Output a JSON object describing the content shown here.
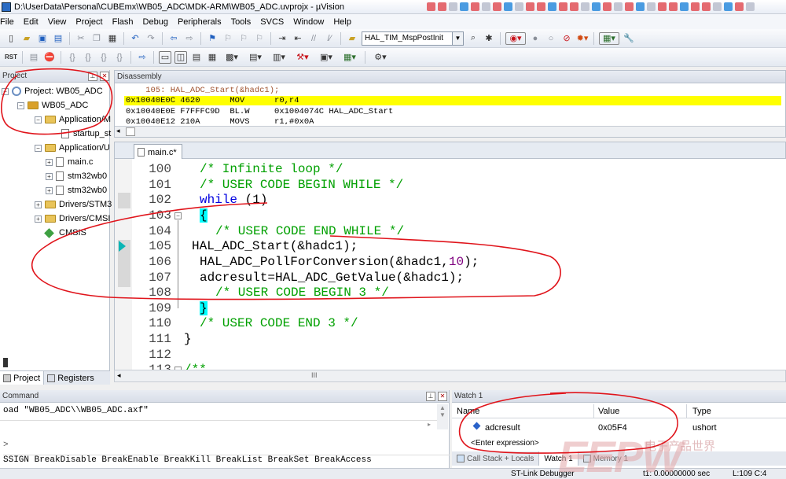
{
  "window": {
    "title": "D:\\UserData\\Personal\\CUBEmx\\WB05_ADC\\MDK-ARM\\WB05_ADC.uvprojx - µVision"
  },
  "menu": [
    "File",
    "Edit",
    "View",
    "Project",
    "Flash",
    "Debug",
    "Peripherals",
    "Tools",
    "SVCS",
    "Window",
    "Help"
  ],
  "toolbar": {
    "function_combo": "HAL_TIM_MspPostInit",
    "rst_label": "RST"
  },
  "project_panel": {
    "title": "Project",
    "items": [
      {
        "label": "Project: WB05_ADC"
      },
      {
        "label": "WB05_ADC"
      },
      {
        "label": "Application/M"
      },
      {
        "label": "startup_st"
      },
      {
        "label": "Application/U"
      },
      {
        "label": "main.c"
      },
      {
        "label": "stm32wb0"
      },
      {
        "label": "stm32wb0"
      },
      {
        "label": "Drivers/STM3"
      },
      {
        "label": "Drivers/CMSI"
      },
      {
        "label": "CMSIS"
      }
    ],
    "tabs": {
      "project": "Project",
      "registers": "Registers"
    }
  },
  "disassembly": {
    "title": "Disassembly",
    "lines": [
      "    105: HAL_ADC_Start(&hadc1);",
      "0x10040E0C 4620      MOV      r0,r4",
      "0x10040E0E F7FFFC9D  BL.W     0x1004074C HAL_ADC_Start",
      "0x10040E12 210A      MOVS     r1,#0x0A"
    ]
  },
  "editor": {
    "tab": "main.c*",
    "line_numbers": [
      "100",
      "101",
      "102",
      "103",
      "104",
      "105",
      "106",
      "107",
      "108",
      "109",
      "110",
      "111",
      "112",
      "113"
    ],
    "lines": {
      "l100": "/* Infinite loop */",
      "l101": "/* USER CODE BEGIN WHILE */",
      "l102_kw": "while",
      "l102_rest": " (1)",
      "l103": "{",
      "l104": "/* USER CODE END WHILE */",
      "l105": "HAL_ADC_Start(&hadc1);",
      "l106_a": "HAL_ADC_PollForConversion(&hadc1,",
      "l106_num": "10",
      "l106_b": ");",
      "l107": "adcresult=HAL_ADC_GetValue(&hadc1);",
      "l108": "/* USER CODE BEGIN 3 */",
      "l109": "}",
      "l110": "/* USER CODE END 3 */",
      "l111": "}",
      "l112": "",
      "l113": "/**"
    },
    "hscroll_label": "III"
  },
  "command": {
    "title": "Command",
    "lines": [
      "oad \"WB05_ADC\\\\WB05_ADC.axf\"",
      ">",
      "SSIGN BreakDisable BreakEnable BreakKill BreakList BreakSet BreakAccess"
    ]
  },
  "watch": {
    "title": "Watch 1",
    "columns": [
      "Name",
      "Value",
      "Type"
    ],
    "rows": [
      {
        "name": "adcresult",
        "value": "0x05F4",
        "type": "ushort"
      }
    ],
    "enter_expression": "<Enter expression>",
    "tabs": [
      "Call Stack + Locals",
      "Watch 1",
      "Memory 1"
    ]
  },
  "status": {
    "debugger": "ST-Link Debugger",
    "time": "t1: 0.00000000 sec",
    "position": "L:109 C:4"
  },
  "watermark": {
    "brand": "EEPW",
    "tagline": "电子产品世界"
  },
  "colors": {
    "highlight_line": "#ffff00",
    "annotation": "#e0141b",
    "comment": "#00a000",
    "keyword": "#0000e0",
    "brace_highlight": "#00ffff"
  }
}
